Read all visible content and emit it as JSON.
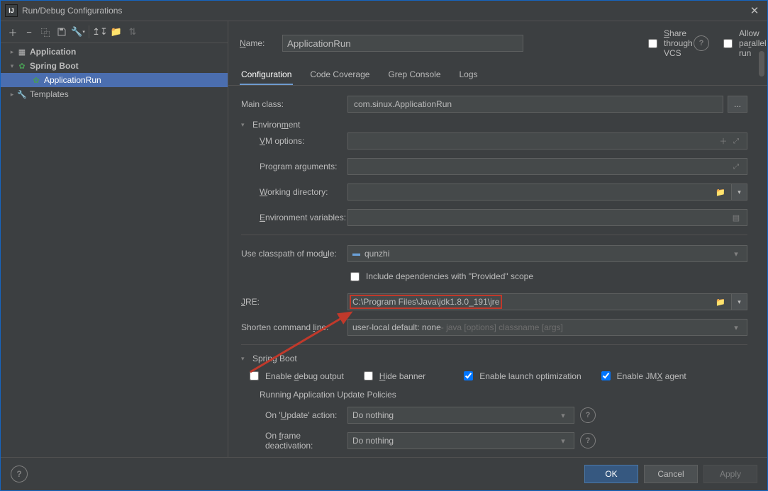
{
  "title": "Run/Debug Configurations",
  "toolbar_icons": {
    "add": "+",
    "remove": "−",
    "copy": "⿻",
    "save": "💾",
    "wrench": "🔧",
    "tree": "↧",
    "folder": "📁",
    "order": "⇅"
  },
  "tree": {
    "application": {
      "label": "Application"
    },
    "springboot": {
      "label": "Spring Boot"
    },
    "app_run": {
      "label": "ApplicationRun"
    },
    "templates": {
      "label": "Templates"
    }
  },
  "name_label": "Name:",
  "name_value": "ApplicationRun",
  "share_vcs": "Share through VCS",
  "allow_parallel": "Allow parallel run",
  "tabs": {
    "config": "Configuration",
    "code_cov": "Code Coverage",
    "grep": "Grep Console",
    "logs": "Logs"
  },
  "lab": {
    "main_class": "Main class:",
    "environment": "Environment",
    "vm_options": "VM options:",
    "program_args": "Program arguments:",
    "working_dir": "Working directory:",
    "env_vars": "Environment variables:",
    "classpath": "Use classpath of module:",
    "include_deps": "Include dependencies with \"Provided\" scope",
    "jre": "JRE:",
    "shorten": "Shorten command line:",
    "spring_boot": "Spring Boot",
    "enable_debug": "Enable debug output",
    "hide_banner": "Hide banner",
    "enable_launch": "Enable launch optimization",
    "enable_jmx": "Enable JMX agent",
    "policies": "Running Application Update Policies",
    "on_update": "On 'Update' action:",
    "on_frame": "On frame deactivation:"
  },
  "val": {
    "main_class": "com.sinux.ApplicationRun",
    "classpath": "qunzhi",
    "jre": "C:\\Program Files\\Java\\jdk1.8.0_191\\jre",
    "shorten": "user-local default: none",
    "shorten_hint": " - java [options] classname [args]",
    "do_nothing": "Do nothing"
  },
  "chk": {
    "enable_launch": true,
    "enable_jmx": true
  },
  "btn": {
    "ok": "OK",
    "cancel": "Cancel",
    "apply": "Apply"
  },
  "glyph": {
    "more": "...",
    "plus": "＋",
    "expand": "⤢",
    "folder": "📁",
    "list": "≣",
    "down": "▼",
    "open": "▸",
    "opened": "▾",
    "module": "■",
    "spring": "✿",
    "file": "📄",
    "wrench": "🔧",
    "info": "?",
    "envopen": "▾"
  }
}
